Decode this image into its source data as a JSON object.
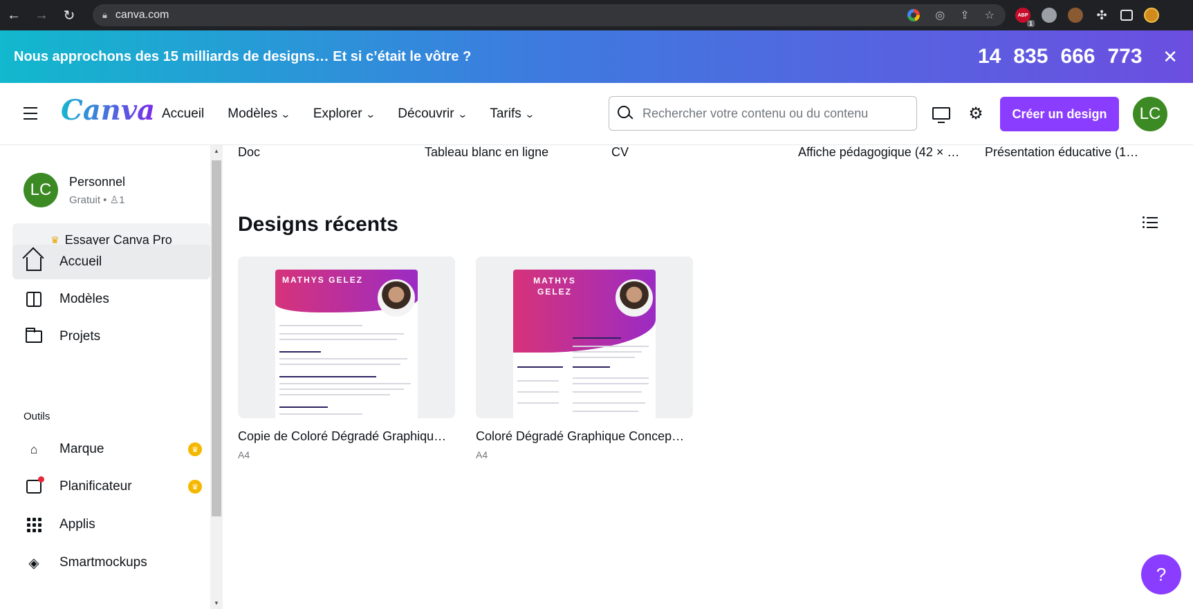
{
  "browser": {
    "url": "canva.com",
    "ext_badge": "1",
    "abp_label": "ABP"
  },
  "banner": {
    "message": "Nous approchons des 15 milliards de designs… Et si c’était le vôtre ?",
    "counter": [
      "14",
      "835",
      "666",
      "773"
    ],
    "close": "✕"
  },
  "topnav": {
    "logo": "Canva",
    "menu": [
      {
        "label": "Accueil",
        "dropdown": false
      },
      {
        "label": "Modèles",
        "dropdown": true
      },
      {
        "label": "Explorer",
        "dropdown": true
      },
      {
        "label": "Découvrir",
        "dropdown": true
      },
      {
        "label": "Tarifs",
        "dropdown": true
      }
    ],
    "search_placeholder": "Rechercher votre contenu ou du contenu",
    "create_button": "Créer un design",
    "avatar_initials": "LC"
  },
  "sidebar": {
    "account": {
      "initials": "LC",
      "name": "Personnel",
      "plan": "Gratuit",
      "members": "1"
    },
    "try_pro": "Essayer Canva Pro",
    "nav": [
      {
        "label": "Accueil",
        "icon": "home-icon",
        "active": true
      },
      {
        "label": "Modèles",
        "icon": "templates-icon",
        "active": false
      },
      {
        "label": "Projets",
        "icon": "folder-icon",
        "active": false
      }
    ],
    "tools_label": "Outils",
    "tools": [
      {
        "label": "Marque",
        "icon": "brand-kit-icon",
        "pro": true
      },
      {
        "label": "Planificateur",
        "icon": "planner-icon",
        "pro": true
      },
      {
        "label": "Applis",
        "icon": "apps-icon",
        "pro": false
      },
      {
        "label": "Smartmockups",
        "icon": "layers-icon",
        "pro": false
      }
    ]
  },
  "main": {
    "template_types": [
      "Doc",
      "Tableau blanc en ligne",
      "CV",
      "Affiche pédagogique (42 × …",
      "Présentation éducative (1…"
    ],
    "recent_title": "Designs récents",
    "designs": [
      {
        "name": "Copie de Coloré Dégradé Graphiqu…",
        "size": "A4",
        "cv_name": "MATHYS GELEZ"
      },
      {
        "name": "Coloré Dégradé Graphique Concep…",
        "size": "A4",
        "cv_name": "MATHYS GELEZ"
      }
    ]
  },
  "help": "?",
  "colors": {
    "accent": "#8b3dff",
    "banner_start": "#12b8cd",
    "banner_end": "#6c4ee0",
    "avatar": "#3c8a24"
  }
}
